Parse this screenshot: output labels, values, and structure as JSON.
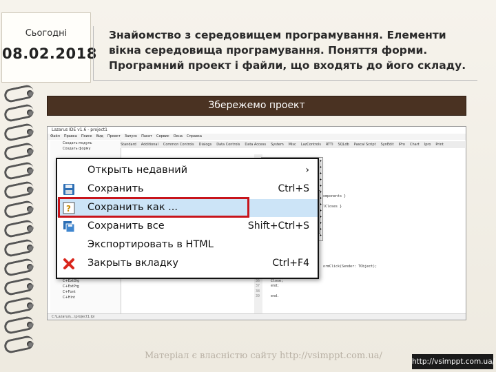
{
  "date_card": {
    "label": "Сьогодні",
    "date": "08.02.2018"
  },
  "title": "Знайомство з середовищем програмування. Елементи вікна середовища програмування. Поняття форми. Програмний проект і файли, що входять до його складу.",
  "banner": "Збережемо проект",
  "screenshot": {
    "window_title": "Lazarus IDE v1.6 - project1",
    "menubar": [
      "Файл",
      "Правка",
      "Поиск",
      "Вид",
      "Проект",
      "Запуск",
      "Пакет",
      "Сервис",
      "Окна",
      "Справка"
    ],
    "component_tabs": [
      "Standard",
      "Additional",
      "Common Controls",
      "Dialogs",
      "Data Controls",
      "Data Access",
      "System",
      "Misc",
      "LazControls",
      "RTTI",
      "SQLdb",
      "Pascal Script",
      "SynEdit",
      "IPro",
      "Chart",
      "Ipro",
      "Print"
    ],
    "left_rows": [
      "Создать модуль",
      "Создать форму",
      "",
      "",
      "",
      "",
      "",
      "",
      "",
      "",
      "",
      "",
      "",
      "",
      "",
      "",
      "",
      "",
      "",
      "",
      "",
      "",
      "",
      "C+ListBox",
      "C+StringGrid",
      "C+ExtDlg",
      "C+ExtPrg",
      "C+Font",
      "C+Hint"
    ],
    "code_lines": [
      "omponents }",
      "lCloses }",
      "ormClick(Sender: TObject);",
      "Close;",
      "end;",
      "end."
    ],
    "gutter_numbers": [
      "36",
      "37",
      "38",
      "39"
    ],
    "status_text": "C:\\Lazarus\\...\\project1.lpi"
  },
  "menu": {
    "items": [
      {
        "label": "Открыть недавний",
        "shortcut": "›",
        "icon": "none-icon"
      },
      {
        "label": "Сохранить",
        "shortcut": "Ctrl+S",
        "icon": "floppy-icon"
      },
      {
        "label": "Сохранить как ...",
        "shortcut": "",
        "icon": "save-as-icon",
        "highlighted": true
      },
      {
        "label": "Сохранить все",
        "shortcut": "Shift+Ctrl+S",
        "icon": "save-all-icon"
      },
      {
        "label": "Экспортировать в HTML",
        "shortcut": "",
        "icon": "none-icon"
      },
      {
        "label": "Закрыть вкладку",
        "shortcut": "Ctrl+F4",
        "icon": "close-x-icon"
      }
    ]
  },
  "watermark": "Матеріал є власністю сайту http://vsimppt.com.ua/",
  "footer_url": "http://vsimppt.com.ua/",
  "colors": {
    "banner": "#4a3222",
    "highlight_frame": "#c8141b",
    "highlight_fill": "#cce4f7"
  }
}
